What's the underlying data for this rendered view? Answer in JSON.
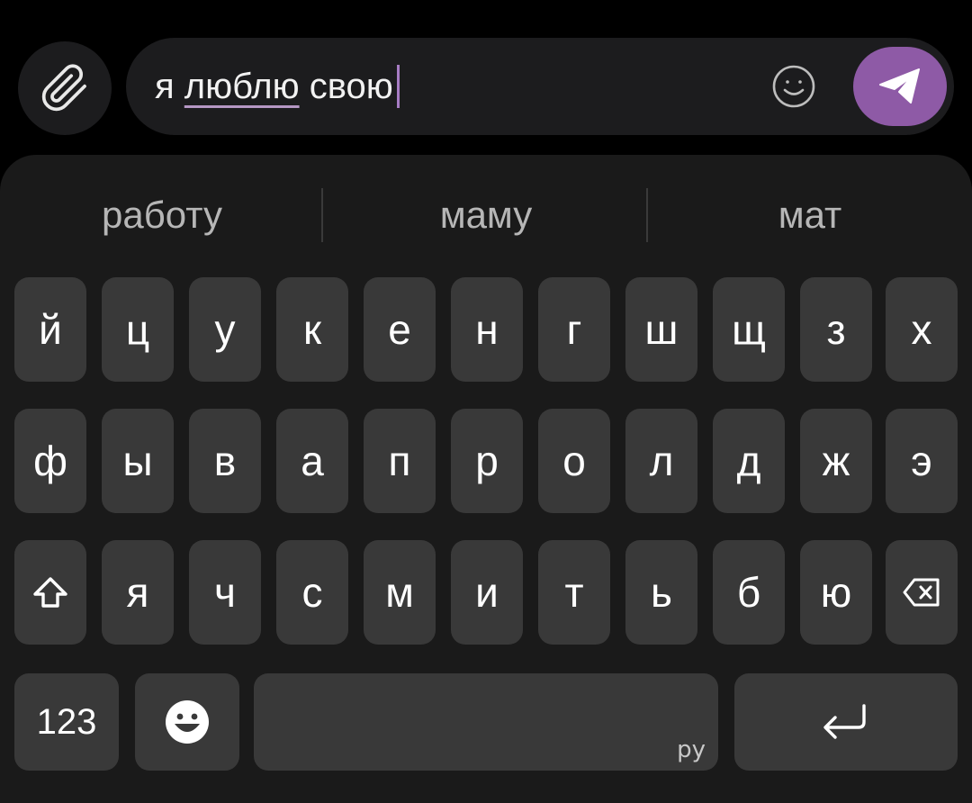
{
  "composer": {
    "input_text_plain": "я ",
    "input_text_underlined": "люблю",
    "input_text_tail": " свою",
    "accent_color": "#8e5aa6"
  },
  "suggestions": [
    "работу",
    "маму",
    "мат"
  ],
  "keyboard": {
    "row1": [
      "й",
      "ц",
      "у",
      "к",
      "е",
      "н",
      "г",
      "ш",
      "щ",
      "з",
      "х"
    ],
    "row2": [
      "ф",
      "ы",
      "в",
      "а",
      "п",
      "р",
      "о",
      "л",
      "д",
      "ж",
      "э"
    ],
    "row3": [
      "я",
      "ч",
      "с",
      "м",
      "и",
      "т",
      "ь",
      "б",
      "ю"
    ],
    "numbers_label": "123",
    "language_label": "ру",
    "icons": {
      "shift": "shift-icon",
      "backspace": "backspace-icon",
      "emoji": "emoji-icon",
      "enter": "enter-icon"
    }
  }
}
